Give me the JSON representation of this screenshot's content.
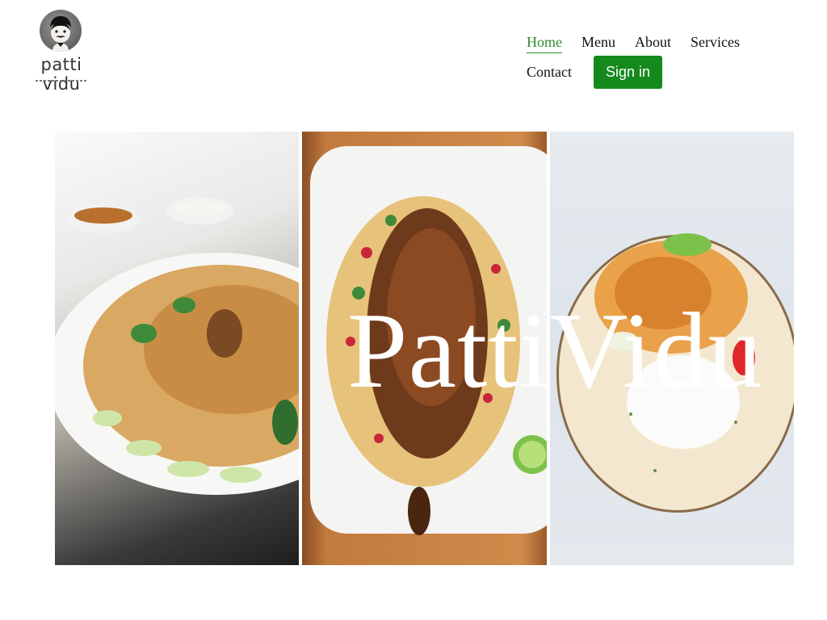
{
  "brand": {
    "name": "patti vidu"
  },
  "nav": {
    "items": [
      {
        "label": "Home",
        "active": true
      },
      {
        "label": "Menu"
      },
      {
        "label": "About"
      },
      {
        "label": "Services"
      },
      {
        "label": "Contact"
      }
    ],
    "signin_label": "Sign in"
  },
  "hero": {
    "title": "PattiVidu",
    "images": [
      "biryani-dish-image",
      "roast-chicken-dish-image",
      "curry-rice-dish-image"
    ]
  },
  "colors": {
    "accent": "#16891c",
    "active_link": "#2e8b2e",
    "text": "#111111",
    "background": "#ffffff"
  }
}
